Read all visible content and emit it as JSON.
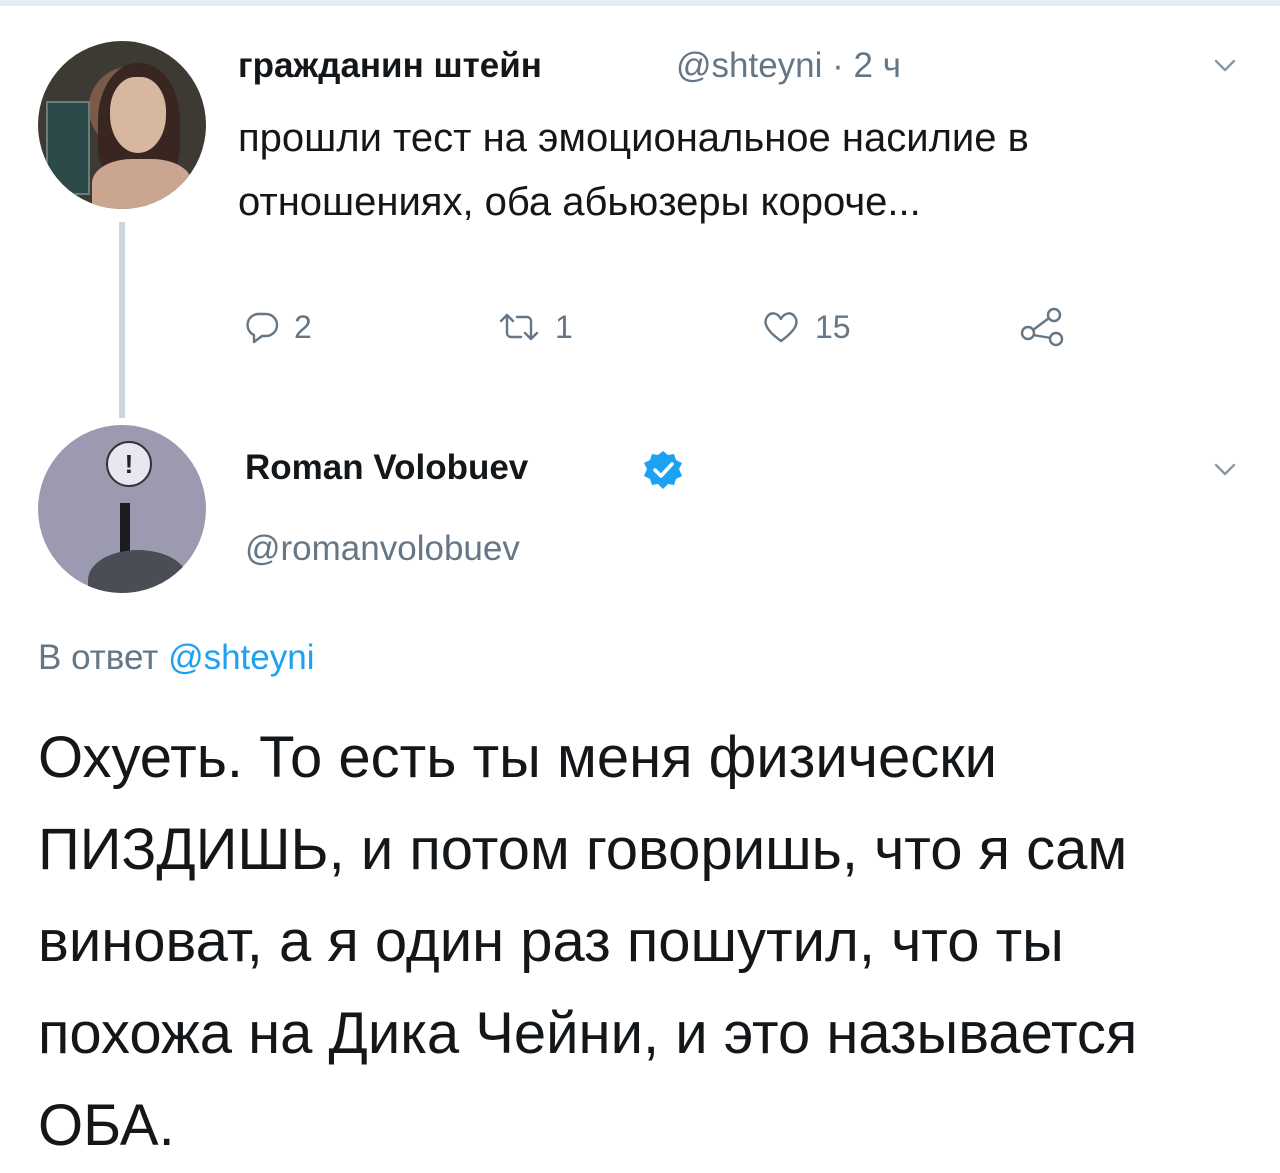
{
  "tweet1": {
    "author_name": "гражданин штейн",
    "handle_time": "@shteyni · 2 ч",
    "text": "прошли тест на эмоциональное насилие в отношениях, оба абьюзеры короче...",
    "actions": {
      "reply_count": "2",
      "retweet_count": "1",
      "like_count": "15"
    }
  },
  "tweet2": {
    "author_name": "Roman Volobuev",
    "handle": "@romanvolobuev",
    "reply_prefix": "В ответ ",
    "reply_mention": "@shteyni",
    "text": "Охуеть. То есть ты меня физически ПИЗДИШЬ, и потом говоришь, что я сам виноват, а я один раз пошутил, что ты похожа на Дика Чейни, и это называется ОБА."
  },
  "icons": {
    "reply": "reply-icon",
    "retweet": "retweet-icon",
    "like": "heart-icon",
    "share": "share-icon",
    "menu": "chevron-down-icon",
    "verified": "verified-badge-icon"
  },
  "colors": {
    "text_primary": "#14171a",
    "text_secondary": "#657786",
    "accent": "#1da1f2",
    "thread_line": "#ccd6dd"
  }
}
